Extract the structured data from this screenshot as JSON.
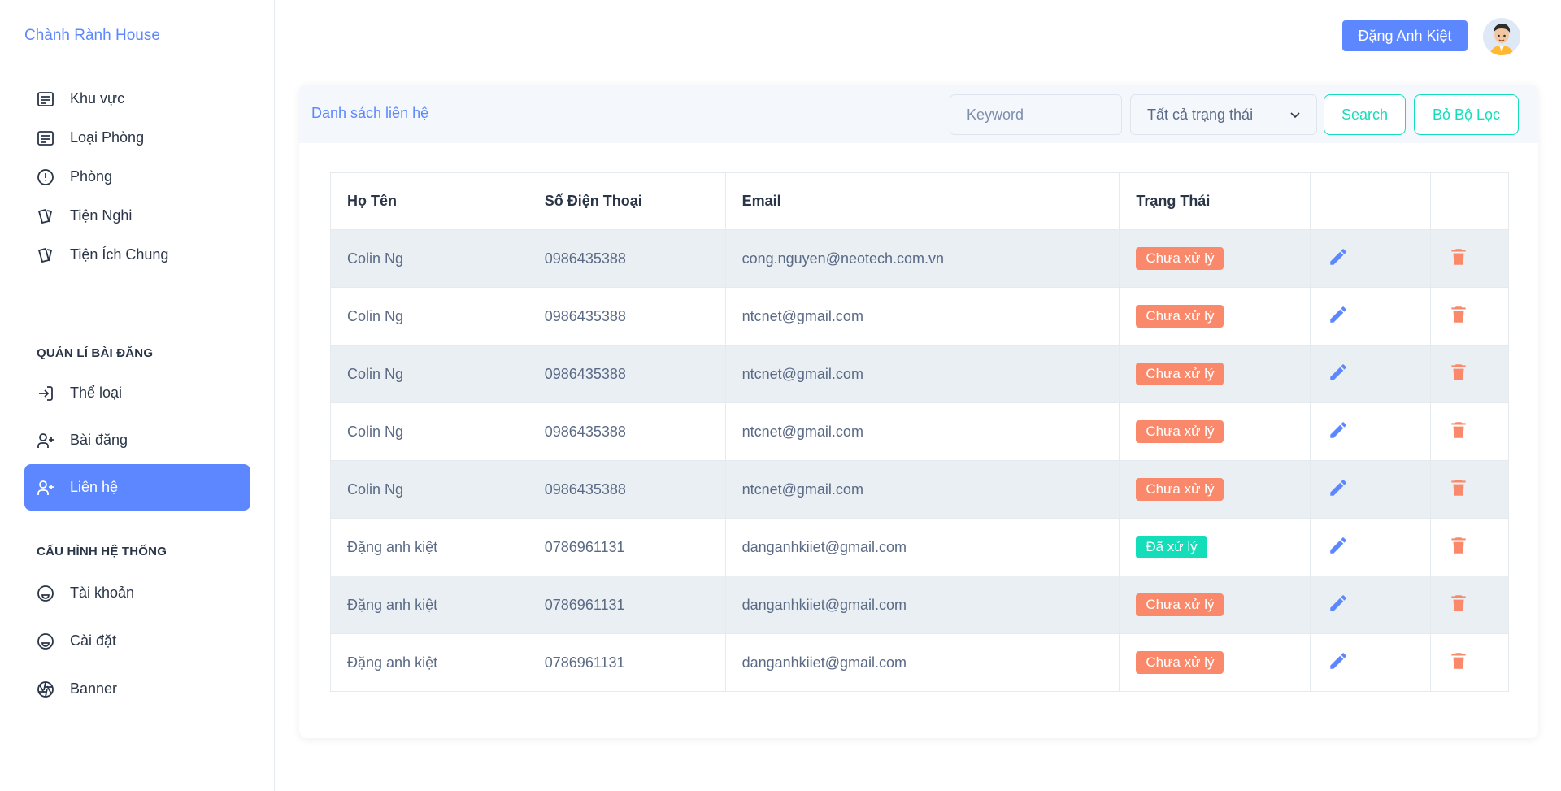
{
  "brand": "Chành Rành House",
  "sidebar": {
    "items": [
      {
        "label": "Khu vực",
        "icon": "list-icon"
      },
      {
        "label": "Loại Phòng",
        "icon": "list-icon"
      },
      {
        "label": "Phòng",
        "icon": "alert-circle-icon"
      },
      {
        "label": "Tiện Nghi",
        "icon": "cards-icon"
      },
      {
        "label": "Tiện Ích Chung",
        "icon": "cards-icon"
      }
    ],
    "section1": "QUẢN LÍ BÀI ĐĂNG",
    "posts": [
      {
        "label": "Thể loại",
        "icon": "login-icon"
      },
      {
        "label": "Bài đăng",
        "icon": "user-plus-icon"
      },
      {
        "label": "Liên hệ",
        "icon": "user-plus-icon",
        "active": true
      }
    ],
    "section2": "CẤU HÌNH HỆ THỐNG",
    "system": [
      {
        "label": "Tài khoản",
        "icon": "mood-icon"
      },
      {
        "label": "Cài đặt",
        "icon": "mood-icon"
      },
      {
        "label": "Banner",
        "icon": "aperture-icon"
      }
    ]
  },
  "header": {
    "user_name": "Đặng Anh Kiệt"
  },
  "panel": {
    "title": "Danh sách liên hệ",
    "keyword_placeholder": "Keyword",
    "status_filter": "Tất cả trạng thái",
    "search_label": "Search",
    "reset_label": "Bỏ Bộ Lọc"
  },
  "table": {
    "columns": [
      "Họ Tên",
      "Số Điện Thoại",
      "Email",
      "Trạng Thái",
      "",
      ""
    ],
    "rows": [
      {
        "name": "Colin Ng",
        "phone": "0986435388",
        "email": "cong.nguyen@neotech.com.vn",
        "status": "Chưa xử lý",
        "done": false
      },
      {
        "name": "Colin Ng",
        "phone": "0986435388",
        "email": "ntcnet@gmail.com",
        "status": "Chưa xử lý",
        "done": false
      },
      {
        "name": "Colin Ng",
        "phone": "0986435388",
        "email": "ntcnet@gmail.com",
        "status": "Chưa xử lý",
        "done": false
      },
      {
        "name": "Colin Ng",
        "phone": "0986435388",
        "email": "ntcnet@gmail.com",
        "status": "Chưa xử lý",
        "done": false
      },
      {
        "name": "Colin Ng",
        "phone": "0986435388",
        "email": "ntcnet@gmail.com",
        "status": "Chưa xử lý",
        "done": false
      },
      {
        "name": "Đặng anh kiệt",
        "phone": "0786961131",
        "email": "danganhkiiet@gmail.com",
        "status": "Đã xử lý",
        "done": true
      },
      {
        "name": "Đặng anh kiệt",
        "phone": "0786961131",
        "email": "danganhkiiet@gmail.com",
        "status": "Chưa xử lý",
        "done": false
      },
      {
        "name": "Đặng anh kiệt",
        "phone": "0786961131",
        "email": "danganhkiiet@gmail.com",
        "status": "Chưa xử lý",
        "done": false
      }
    ]
  },
  "colors": {
    "primary": "#5d87ff",
    "success": "#13deb9",
    "danger": "#fa896b",
    "row_alt": "#eaeff4"
  }
}
